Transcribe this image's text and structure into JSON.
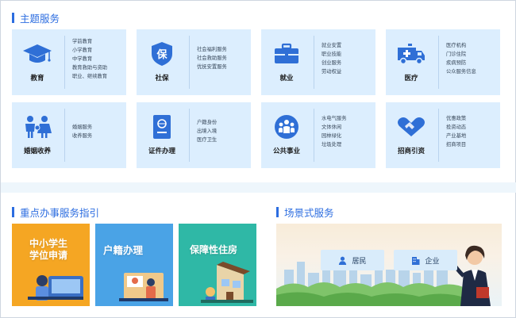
{
  "theme_services": {
    "title": "主题服务",
    "cards": [
      {
        "title": "教育",
        "icon": "graduation-cap-icon",
        "items": [
          "学前教育",
          "小学教育",
          "中学教育",
          "教育救助与资助",
          "职业、继续教育"
        ]
      },
      {
        "title": "社保",
        "icon": "shield-bao-icon",
        "items": [
          "社会福利服务",
          "社会救助服务",
          "优抚安置服务"
        ]
      },
      {
        "title": "就业",
        "icon": "briefcase-icon",
        "items": [
          "就业安置",
          "职业技能",
          "创业服务",
          "劳动权益"
        ]
      },
      {
        "title": "医疗",
        "icon": "ambulance-icon",
        "items": [
          "医疗机构",
          "门诊住院",
          "疾病预防",
          "公众服务信息"
        ]
      },
      {
        "title": "婚姻收养",
        "icon": "family-icon",
        "items": [
          "婚姻服务",
          "收养服务"
        ]
      },
      {
        "title": "证件办理",
        "icon": "passport-icon",
        "items": [
          "户籍身份",
          "出境入境",
          "医疗卫生"
        ]
      },
      {
        "title": "公共事业",
        "icon": "people-group-icon",
        "items": [
          "水电气服务",
          "文体休闲",
          "园林绿化",
          "垃圾处理"
        ]
      },
      {
        "title": "招商引资",
        "icon": "handshake-icon",
        "items": [
          "优惠政策",
          "投资动态",
          "产业基地",
          "招商项目"
        ]
      }
    ]
  },
  "key_guide": {
    "title": "重点办事服务指引",
    "cards": [
      {
        "title_line1": "中小学生",
        "title_line2": "学位申请",
        "color": "#f5a623"
      },
      {
        "title_line1": "户籍办理",
        "title_line2": "",
        "color": "#4aa3e6"
      },
      {
        "title_line1": "保障性住房",
        "title_line2": "",
        "color": "#2fb8a6"
      }
    ]
  },
  "scene_services": {
    "title": "场景式服务",
    "buttons": [
      {
        "label": "居民",
        "icon": "resident-icon"
      },
      {
        "label": "企业",
        "icon": "building-icon"
      }
    ]
  },
  "colors": {
    "accent": "#2c6de0",
    "card_bg": "#dceefe",
    "icon_blue": "#2f6fd6"
  }
}
